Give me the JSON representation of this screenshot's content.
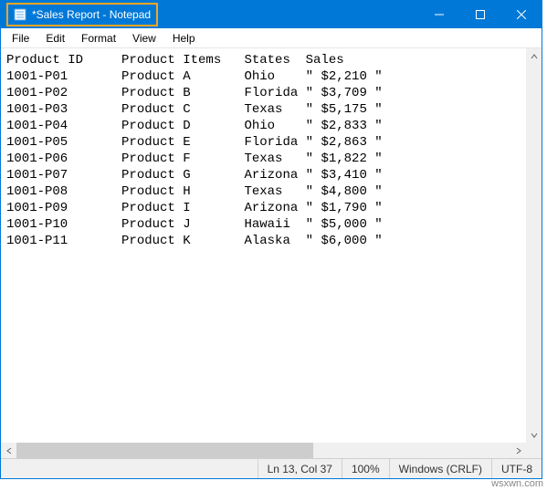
{
  "window": {
    "title": "*Sales Report - Notepad"
  },
  "menu": {
    "file": "File",
    "edit": "Edit",
    "format": "Format",
    "view": "View",
    "help": "Help"
  },
  "statusbar": {
    "position": "Ln 13, Col 37",
    "zoom": "100%",
    "line_ending": "Windows (CRLF)",
    "encoding": "UTF-8"
  },
  "watermark": "wsxwn.com",
  "editor": {
    "headers": [
      "Product ID",
      "Product Items",
      "States",
      "Sales"
    ],
    "rows": [
      {
        "product_id": "1001-P01",
        "product_items": "Product A",
        "states": "Ohio",
        "sales": "\" $2,210 \""
      },
      {
        "product_id": "1001-P02",
        "product_items": "Product B",
        "states": "Florida",
        "sales": "\" $3,709 \""
      },
      {
        "product_id": "1001-P03",
        "product_items": "Product C",
        "states": "Texas",
        "sales": "\" $5,175 \""
      },
      {
        "product_id": "1001-P04",
        "product_items": "Product D",
        "states": "Ohio",
        "sales": "\" $2,833 \""
      },
      {
        "product_id": "1001-P05",
        "product_items": "Product E",
        "states": "Florida",
        "sales": "\" $2,863 \""
      },
      {
        "product_id": "1001-P06",
        "product_items": "Product F",
        "states": "Texas",
        "sales": "\" $1,822 \""
      },
      {
        "product_id": "1001-P07",
        "product_items": "Product G",
        "states": "Arizona",
        "sales": "\" $3,410 \""
      },
      {
        "product_id": "1001-P08",
        "product_items": "Product H",
        "states": "Texas",
        "sales": "\" $4,800 \""
      },
      {
        "product_id": "1001-P09",
        "product_items": "Product I",
        "states": "Arizona",
        "sales": "\" $1,790 \""
      },
      {
        "product_id": "1001-P10",
        "product_items": "Product J",
        "states": "Hawaii",
        "sales": "\" $5,000 \""
      },
      {
        "product_id": "1001-P11",
        "product_items": "Product K",
        "states": "Alaska",
        "sales": "\" $6,000 \""
      }
    ],
    "text": "Product ID     Product Items   States  Sales\n1001-P01       Product A       Ohio    \" $2,210 \"\n1001-P02       Product B       Florida \" $3,709 \"\n1001-P03       Product C       Texas   \" $5,175 \"\n1001-P04       Product D       Ohio    \" $2,833 \"\n1001-P05       Product E       Florida \" $2,863 \"\n1001-P06       Product F       Texas   \" $1,822 \"\n1001-P07       Product G       Arizona \" $3,410 \"\n1001-P08       Product H       Texas   \" $4,800 \"\n1001-P09       Product I       Arizona \" $1,790 \"\n1001-P10       Product J       Hawaii  \" $5,000 \"\n1001-P11       Product K       Alaska  \" $6,000 \""
  }
}
